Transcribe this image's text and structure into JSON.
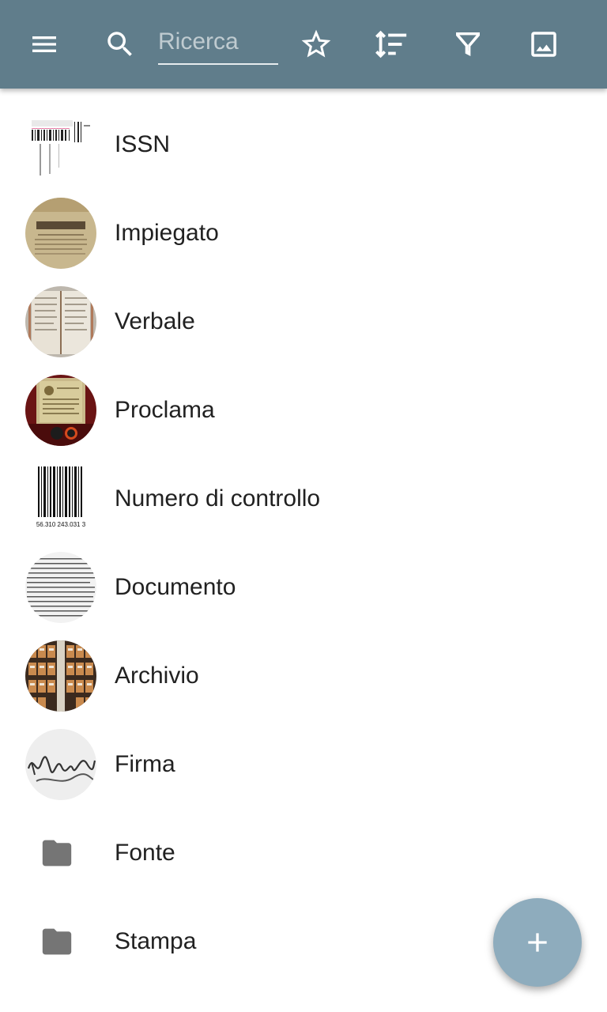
{
  "toolbar": {
    "background": "#607d8b",
    "menu_icon": "menu-icon",
    "search_icon": "search-icon",
    "search_placeholder": "Ricerca",
    "search_value": "",
    "favorites_icon": "star-outline-icon",
    "sort_icon": "sort-icon",
    "filter_icon": "filter-icon",
    "image_icon": "image-icon"
  },
  "items": [
    {
      "label": "ISSN",
      "thumbnail": "issn-barcode-photo"
    },
    {
      "label": "Impiegato",
      "thumbnail": "old-document-photo"
    },
    {
      "label": "Verbale",
      "thumbnail": "open-book-photo"
    },
    {
      "label": "Proclama",
      "thumbnail": "framed-proclamation-photo"
    },
    {
      "label": "Numero di controllo",
      "thumbnail": "barcode-photo",
      "thumbnail_caption": "56.310 243.031 3"
    },
    {
      "label": "Documento",
      "thumbnail": "text-page-photo"
    },
    {
      "label": "Archivio",
      "thumbnail": "archive-shelves-photo"
    },
    {
      "label": "Firma",
      "thumbnail": "signature-photo"
    },
    {
      "label": "Fonte",
      "thumbnail": "folder-icon"
    },
    {
      "label": "Stampa",
      "thumbnail": "folder-icon"
    }
  ],
  "fab": {
    "icon": "plus-icon",
    "color": "#8eacbd"
  }
}
